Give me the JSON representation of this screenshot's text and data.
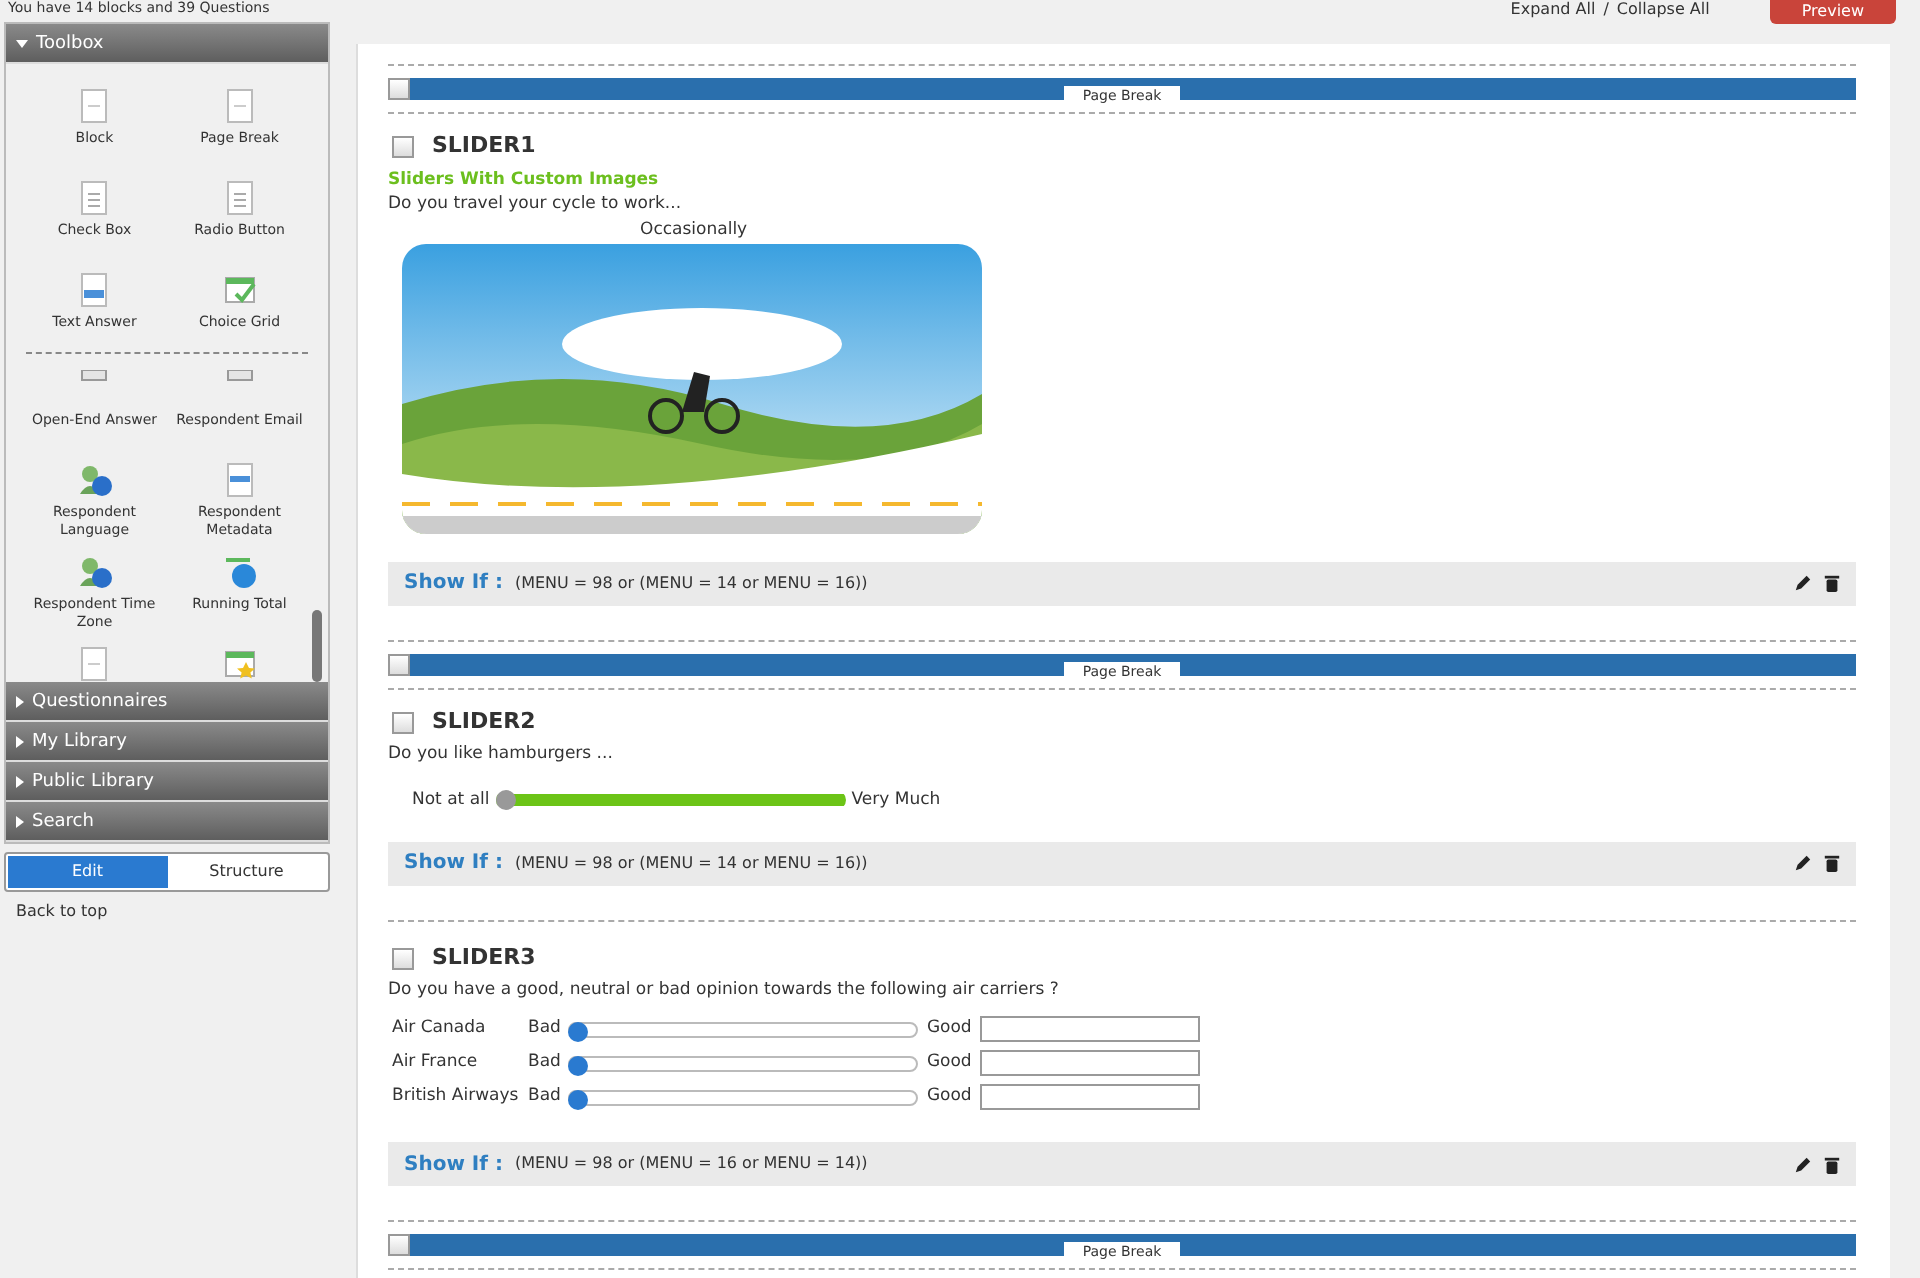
{
  "summary": "You have 14 blocks and 39 Questions",
  "toolbox": {
    "title": "Toolbox",
    "expanded": true,
    "items": [
      {
        "label": "Block"
      },
      {
        "label": "Page Break"
      },
      {
        "label": "Check Box"
      },
      {
        "label": "Radio Button"
      },
      {
        "label": "Text Answer"
      },
      {
        "label": "Choice Grid"
      }
    ],
    "more_items": [
      {
        "label": "Open-End Answer"
      },
      {
        "label": "Respondent Email"
      },
      {
        "label": "Respondent Language"
      },
      {
        "label": "Respondent Metadata"
      },
      {
        "label": "Respondent Time Zone"
      },
      {
        "label": "Running Total"
      }
    ]
  },
  "panels": [
    {
      "title": "Questionnaires",
      "expanded": false
    },
    {
      "title": "My Library",
      "expanded": false
    },
    {
      "title": "Public Library",
      "expanded": false
    },
    {
      "title": "Search",
      "expanded": false
    }
  ],
  "view_toggle": [
    {
      "label": "Edit",
      "selected": true
    },
    {
      "label": "Structure",
      "selected": false
    }
  ],
  "back_to_top": "Back to top",
  "toolbar": {
    "expand": "Expand All",
    "separator": "/",
    "collapse": "Collapse All",
    "preview": "Preview"
  },
  "blocks": [
    {
      "kind": "page_break",
      "label": "Page Break",
      "checked": false
    },
    {
      "kind": "image_slider",
      "title": "SLIDER1",
      "checked": false,
      "subtitle": "Sliders With Custom Images",
      "question": "Do you travel your cycle to work...",
      "value_label": "Occasionally",
      "show_if_label": "Show If :",
      "condition": "(MENU = 98 or (MENU = 14 or MENU = 16))"
    },
    {
      "kind": "page_break",
      "label": "Page Break",
      "checked": false
    },
    {
      "kind": "range_slider",
      "title": "SLIDER2",
      "checked": false,
      "question": "Do you like hamburgers ...",
      "min_label": "Not at all",
      "max_label": "Very Much",
      "level": 0,
      "show_if_label": "Show If :",
      "condition": "(MENU = 98 or (MENU = 14 or MENU = 16))"
    },
    {
      "kind": "grid_slider",
      "title": "SLIDER3",
      "checked": false,
      "question": "Do you have a good, neutral or bad opinion towards the following air carriers ?",
      "rows": [
        {
          "label": "Air Canada",
          "min_label": "Bad",
          "max_label": "Good",
          "level": 0
        },
        {
          "label": "Air France",
          "min_label": "Bad",
          "max_label": "Good",
          "level": 0
        },
        {
          "label": "British Airways",
          "min_label": "Bad",
          "max_label": "Good",
          "level": 0
        }
      ],
      "show_if_label": "Show If :",
      "condition": "(MENU = 98 or (MENU = 16 or MENU = 14))"
    },
    {
      "kind": "page_break",
      "label": "Page Break",
      "checked": false
    }
  ]
}
